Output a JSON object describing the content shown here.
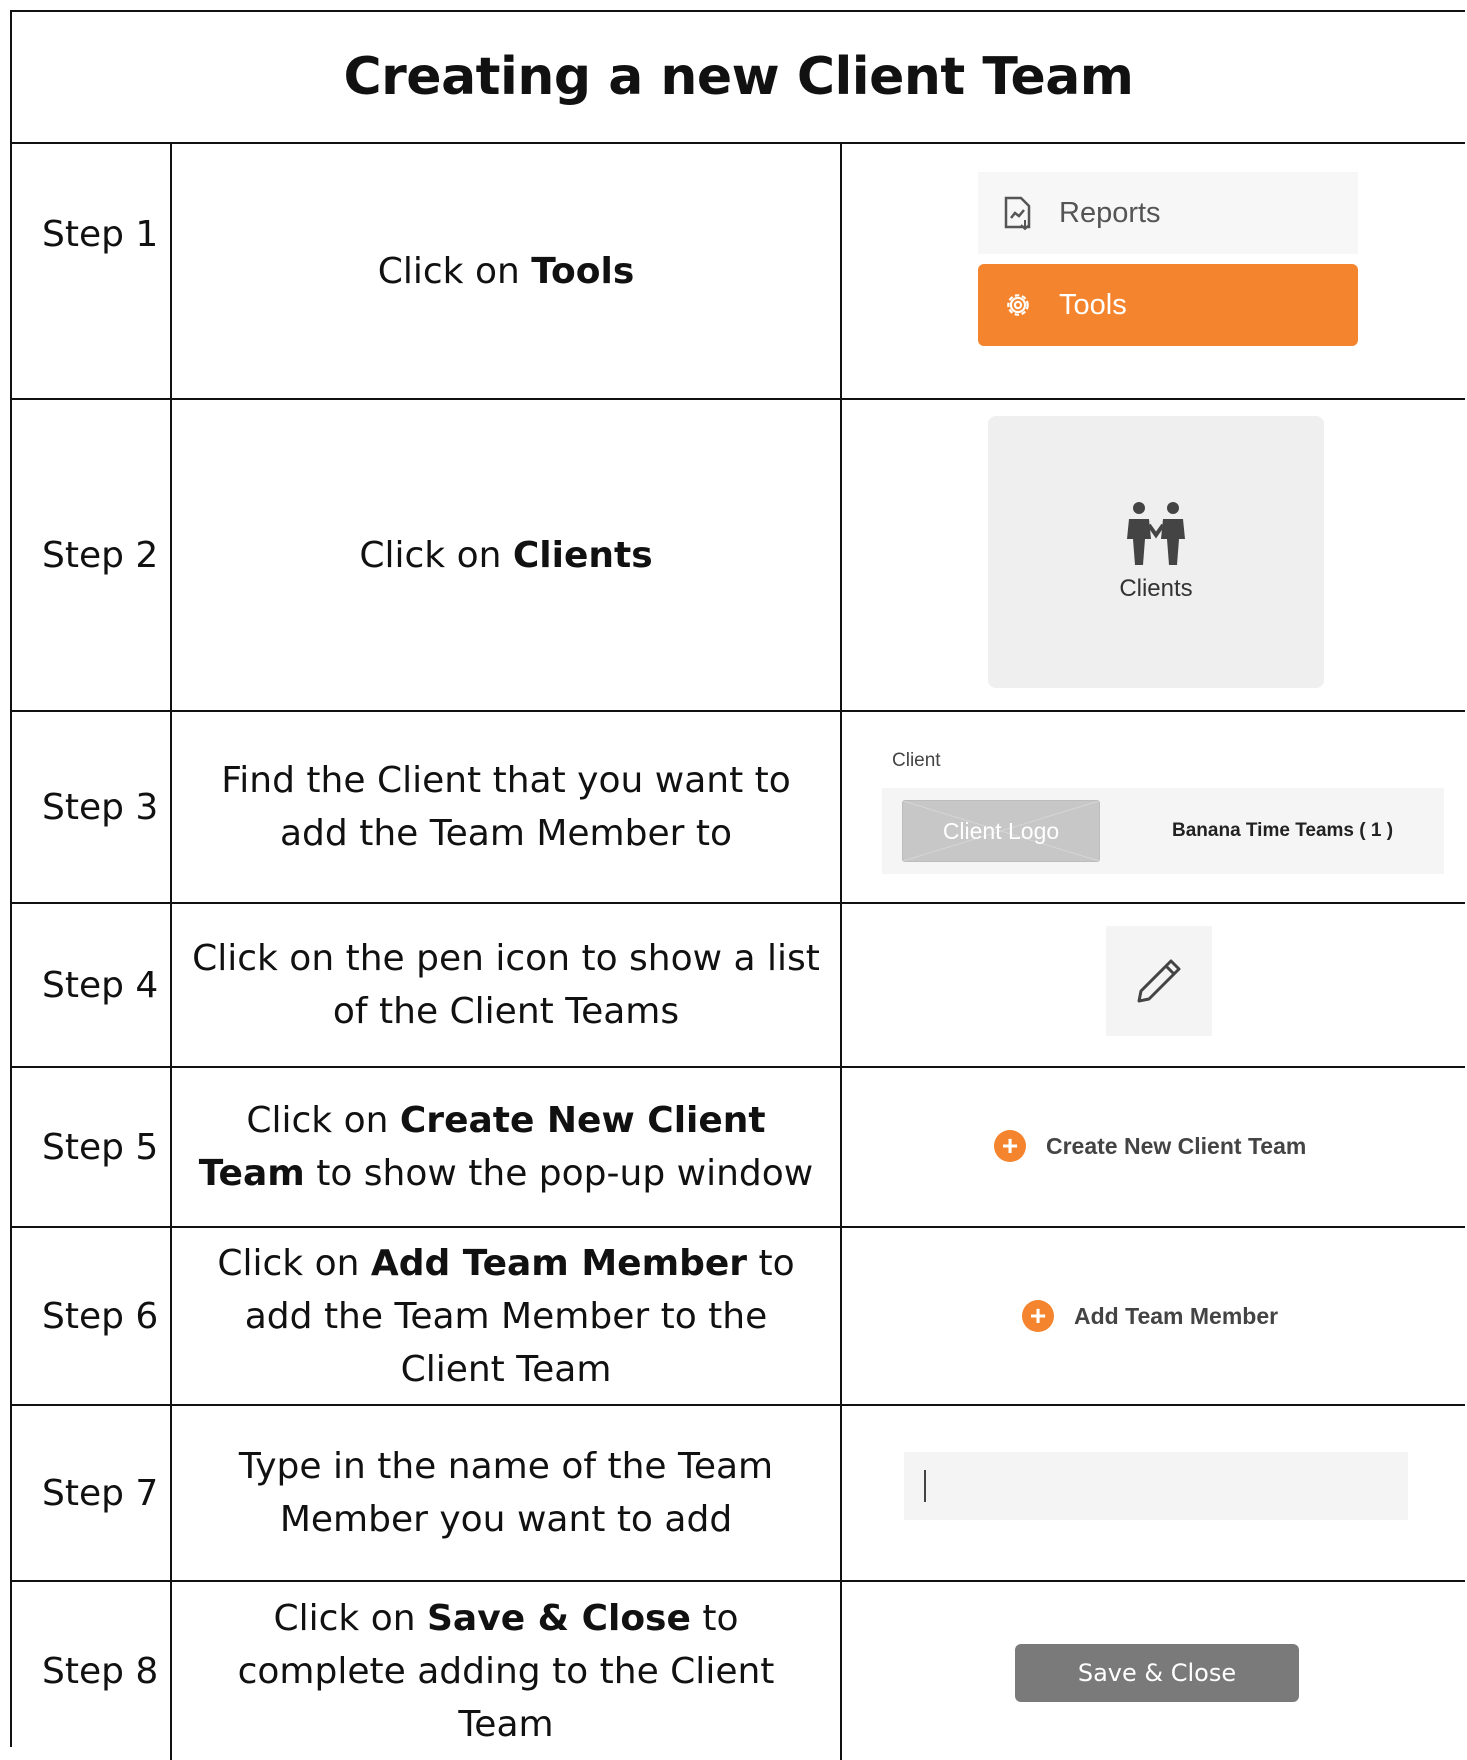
{
  "title": "Creating a new Client Team",
  "steps": [
    {
      "label": "Step 1",
      "desc_parts": [
        "Click on ",
        "Tools",
        ""
      ]
    },
    {
      "label": "Step 2",
      "desc_parts": [
        "Click on ",
        "Clients",
        ""
      ]
    },
    {
      "label": "Step 3",
      "desc": "Find the Client that you want to add the Team Member to"
    },
    {
      "label": "Step 4",
      "desc": "Click on the pen icon to show a list of the Client Teams"
    },
    {
      "label": "Step 5",
      "desc_parts": [
        "Click on ",
        "Create New Client Team",
        " to show the pop-up window"
      ]
    },
    {
      "label": "Step 6",
      "desc_parts": [
        "Click on ",
        "Add Team Member",
        " to add the Team Member to the Client Team"
      ]
    },
    {
      "label": "Step 7",
      "desc": "Type in the name of the Team Member you want to add"
    },
    {
      "label": "Step 8",
      "desc_parts": [
        "Click on ",
        "Save & Close",
        " to complete adding to the Client Team"
      ]
    }
  ],
  "visuals": {
    "reports_label": "Reports",
    "tools_label": "Tools",
    "clients_label": "Clients",
    "client_field_label": "Client",
    "client_logo_text": "Client Logo",
    "client_team_name": "Banana Time Teams ( 1 )",
    "create_team_label": "Create New Client Team",
    "add_member_label": "Add Team Member",
    "save_close_label": "Save & Close"
  },
  "colors": {
    "accent": "#f4842d",
    "button_gray": "#7a7a7a"
  }
}
